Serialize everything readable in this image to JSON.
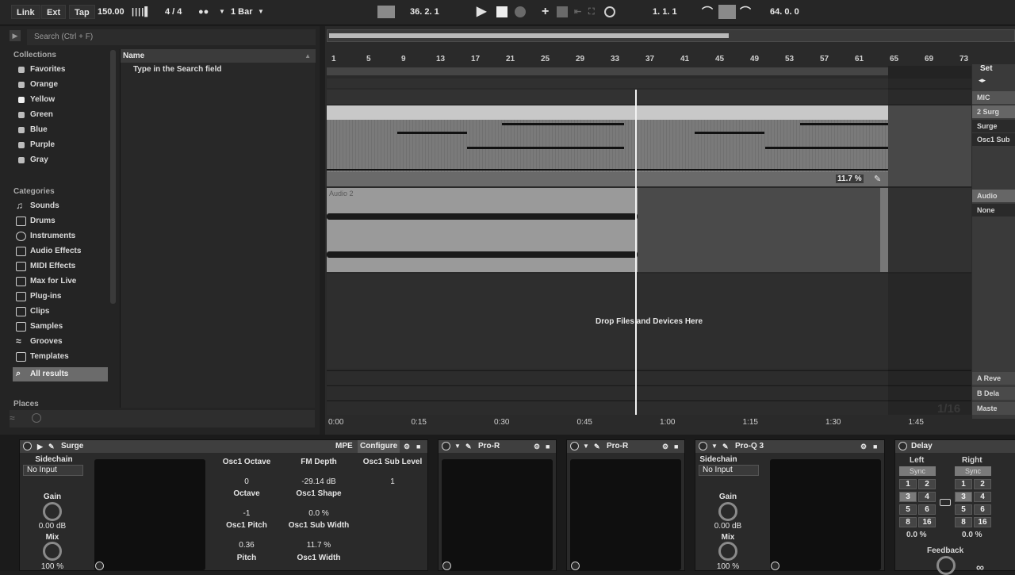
{
  "toolbar": {
    "link": "Link",
    "ext": "Ext",
    "tap": "Tap",
    "tempo": "150.00",
    "signature": "4 / 4",
    "quantize": "1 Bar",
    "arrangement_position": "36.  2.  1",
    "loop_start": "1.  1.  1",
    "loop_length": "64.  0.  0"
  },
  "browser": {
    "search_placeholder": "Search (Ctrl + F)",
    "collections_title": "Collections",
    "collections": [
      "Favorites",
      "Orange",
      "Yellow",
      "Green",
      "Blue",
      "Purple",
      "Gray"
    ],
    "categories_title": "Categories",
    "categories": [
      "Sounds",
      "Drums",
      "Instruments",
      "Audio Effects",
      "MIDI Effects",
      "Max for Live",
      "Plug-ins",
      "Clips",
      "Samples",
      "Grooves",
      "Templates",
      "All results"
    ],
    "places_title": "Places",
    "name_header": "Name",
    "hint": "Type in the Search field"
  },
  "arranger": {
    "bar_numbers": [
      "1",
      "5",
      "9",
      "13",
      "17",
      "21",
      "25",
      "29",
      "33",
      "37",
      "41",
      "45",
      "49",
      "53",
      "57",
      "61",
      "65",
      "69",
      "73"
    ],
    "automation_value": "11.7 %",
    "audio_clip_name": "Audio 2",
    "drop_hint": "Drop Files and Devices Here",
    "time_labels": [
      "0:00",
      "0:15",
      "0:30",
      "0:45",
      "1:00",
      "1:15",
      "1:30",
      "1:45"
    ],
    "grid_label": "1/16",
    "right_column": {
      "set": "Set",
      "mic": "MIC",
      "track2": "2 Surg",
      "device": "Surge",
      "param": "Osc1 Sub",
      "audio": "Audio",
      "none": "None",
      "return_a": "A Reve",
      "return_b": "B Dela",
      "master": "Maste"
    }
  },
  "devices": {
    "surge": {
      "title": "Surge",
      "mpe": "MPE",
      "configure": "Configure",
      "sidechain": "Sidechain",
      "input": "No Input",
      "gain_label": "Gain",
      "gain_value": "0.00 dB",
      "mix_label": "Mix",
      "mix_value": "100 %",
      "params": [
        {
          "label": "Osc1 Octave",
          "value": "0"
        },
        {
          "label": "FM Depth",
          "value": "-29.14 dB"
        },
        {
          "label": "Osc1 Sub Level",
          "value": "1"
        },
        {
          "label": "Octave",
          "value": "-1"
        },
        {
          "label": "Osc1 Shape",
          "value": "0.0 %"
        },
        {
          "label": "Osc1 Pitch",
          "value": "0.36"
        },
        {
          "label": "Osc1 Sub Width",
          "value": "11.7 %"
        },
        {
          "label": "Pitch",
          "value": ""
        },
        {
          "label": "Osc1 Width",
          "value": ""
        }
      ]
    },
    "pro_r_1": {
      "title": "Pro-R"
    },
    "pro_r_2": {
      "title": "Pro-R"
    },
    "pro_q3": {
      "title": "Pro-Q 3",
      "sidechain": "Sidechain",
      "input": "No Input",
      "gain_label": "Gain",
      "gain_value": "0.00 dB",
      "mix_label": "Mix",
      "mix_value": "100 %"
    },
    "delay": {
      "title": "Delay",
      "left": "Left",
      "right": "Right",
      "sync": "Sync",
      "grid": [
        "1",
        "2",
        "3",
        "4",
        "5",
        "6",
        "8",
        "16"
      ],
      "left_value": "0.0 %",
      "right_value": "0.0 %",
      "feedback": "Feedback"
    }
  }
}
